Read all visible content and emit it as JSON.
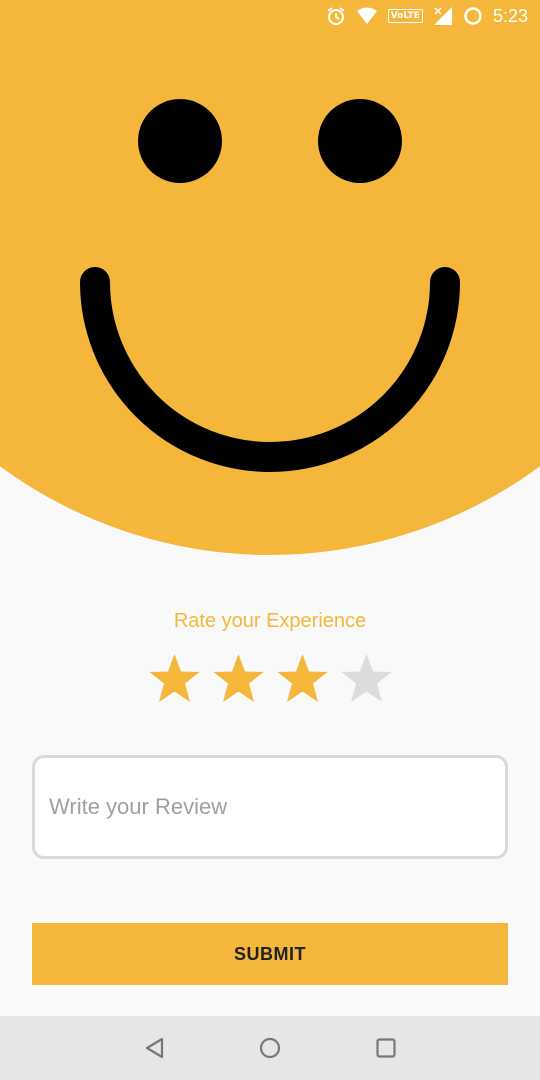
{
  "status_bar": {
    "time": "5:23",
    "network_badge": "VoLTE",
    "icons": [
      "alarm-icon",
      "wifi-icon",
      "volte-icon",
      "signal-icon",
      "battery-icon"
    ]
  },
  "face": {
    "color": "#f5b73b",
    "feature_color": "#000000",
    "expression": "smile"
  },
  "rating": {
    "label": "Rate your Experience",
    "value": 3,
    "max": 5,
    "active_color": "#f5b73b",
    "inactive_color": "#dcdcdc"
  },
  "review": {
    "value": "",
    "placeholder": "Write your Review"
  },
  "submit": {
    "label": "SUBMIT",
    "color": "#f5b73b"
  },
  "nav_bar": {
    "icons": [
      "back-icon",
      "home-icon",
      "recents-icon"
    ]
  }
}
